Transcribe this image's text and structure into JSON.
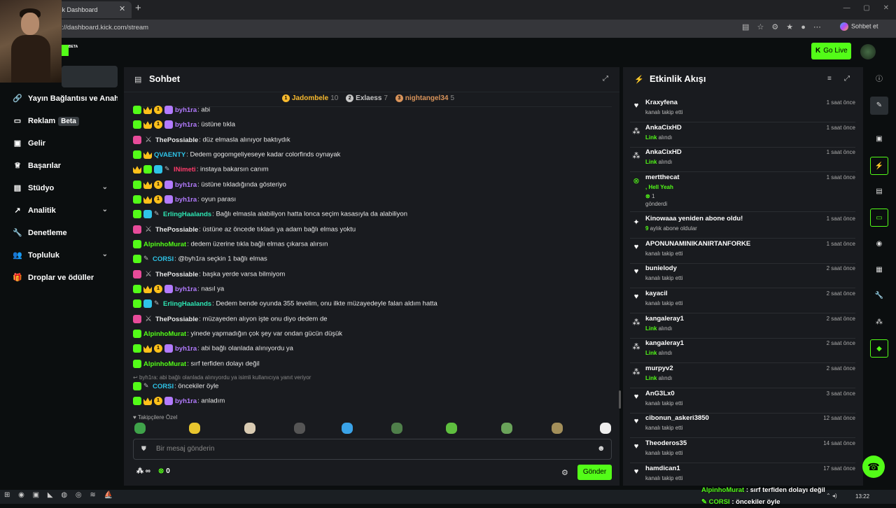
{
  "browser": {
    "tab_title": "ck Dashboard",
    "url": "://dashboard.kick.com/stream",
    "copilot_label": "Sohbet et"
  },
  "topbar": {
    "beta_tag": "BETA",
    "go_live_label": "Go Live"
  },
  "sidebar": {
    "items": [
      {
        "label": "Yayın Bağlantısı ve Anahtarı",
        "icon": "link-icon"
      },
      {
        "label": "Reklam",
        "icon": "ad-icon",
        "badge": "Beta"
      },
      {
        "label": "Gelir",
        "icon": "revenue-icon"
      },
      {
        "label": "Başarılar",
        "icon": "trophy-icon"
      },
      {
        "label": "Stüdyo",
        "icon": "studio-icon",
        "expandable": true
      },
      {
        "label": "Analitik",
        "icon": "analytics-icon",
        "expandable": true
      },
      {
        "label": "Denetleme",
        "icon": "wrench-icon"
      },
      {
        "label": "Topluluk",
        "icon": "community-icon",
        "expandable": true
      },
      {
        "label": "Droplar ve ödüller",
        "icon": "gift-icon"
      }
    ]
  },
  "chat": {
    "title": "Sohbet",
    "leaderboard": [
      {
        "rank": "1",
        "name": "Jadombele",
        "count": "10",
        "color": "#f5b82e"
      },
      {
        "rank": "2",
        "name": "Exlaess",
        "count": "7",
        "color": "#c7c7c7"
      },
      {
        "rank": "3",
        "name": "nightangel34",
        "count": "5",
        "color": "#d8935a"
      }
    ],
    "messages": [
      {
        "user": "byh1ra",
        "color": "#b37bff",
        "text": ": abi"
      },
      {
        "user": "byh1ra",
        "color": "#b37bff",
        "text": ": üstüne tıkla"
      },
      {
        "user": "ThePossiable",
        "color": "#e8e8e8",
        "text": ": düz elmasla alınıyor baktıydık"
      },
      {
        "user": "QVAENTY",
        "color": "#2ec4e8",
        "text": ": Dedem gogomgeliyeseye kadar colorfinds oynayak"
      },
      {
        "user": "INimeti",
        "color": "#ff3b6b",
        "text": ": instaya bakarsın canım"
      },
      {
        "user": "byh1ra",
        "color": "#b37bff",
        "text": ": üstüne tıkladığında gösteriyo"
      },
      {
        "user": "byh1ra",
        "color": "#b37bff",
        "text": ": oyun parası"
      },
      {
        "user": "ErlingHaalands",
        "color": "#2ee8b5",
        "text": ": Bağlı elmasla alabiliyon hatta lonca seçim kasasıyla da alabiliyon"
      },
      {
        "user": "ThePossiable",
        "color": "#e8e8e8",
        "text": ": üstüne az öncede tıkladı ya adam bağlı elmas yoktu"
      },
      {
        "user": "AlpinhoMurat",
        "color": "#53fc18",
        "text": ": dedem üzerine tıkla bağlı elmas çıkarsa alırsın"
      },
      {
        "user": "CORSI",
        "color": "#2ec4e8",
        "text": ": @byh1ra seçkin 1 bağlı elmas"
      },
      {
        "user": "ThePossiable",
        "color": "#e8e8e8",
        "text": ": başka yerde varsa bilmiyom"
      },
      {
        "user": "byh1ra",
        "color": "#b37bff",
        "text": ": nasıl ya"
      },
      {
        "user": "ErlingHaalands",
        "color": "#2ee8b5",
        "text": ": Dedem bende oyunda 355 levelim, onu ilkte müzayedeyle falan aldım hatta"
      },
      {
        "user": "ThePossiable",
        "color": "#e8e8e8",
        "text": ": müzayeden alıyon işte onu diyo dedem de"
      },
      {
        "user": "AlpinhoMurat",
        "color": "#53fc18",
        "text": ": yinede yapmadığın çok şey var ondan gücün düşük"
      },
      {
        "user": "byh1ra",
        "color": "#b37bff",
        "text": ": abi bağlı olanlada alınıyordu ya"
      },
      {
        "user": "AlpinhoMurat",
        "color": "#53fc18",
        "text": ": sırf terfiden dolayı değil"
      },
      {
        "user": "CORSI",
        "color": "#2ec4e8",
        "text": ": öncekiler öyle"
      },
      {
        "user": "byh1ra",
        "color": "#b37bff",
        "text": ": anladım"
      }
    ],
    "reply_hint": "byh1ra: abi bağlı olanlada alınıyordu ya isimli kullanıcıya yanıt veriyor",
    "followers_label": "Takipçilere Özel",
    "input_placeholder": "Bir mesaj gönderin",
    "points_value": "∞",
    "kick_points": "0",
    "send_label": "Gönder"
  },
  "feed": {
    "title": "Etkinlik Akışı",
    "events": [
      {
        "name": "Kraxyfena",
        "sub": "kanalı takip etti",
        "time": "1 saat önce",
        "icon": "heart-icon"
      },
      {
        "name": "AnkaCixHD",
        "sub_bold": "Link",
        "sub": " alındı",
        "time": "1 saat önce",
        "icon": "reward-icon"
      },
      {
        "name": "AnkaCixHD",
        "sub_bold": "Link",
        "sub": " alındı",
        "time": "1 saat önce",
        "icon": "reward-icon"
      },
      {
        "name": "mertthecat",
        "sub_bold": ", Hell Yeah",
        "sub2": "1",
        "sub": "gönderdi",
        "time": "1 saat önce",
        "icon": "kicks-icon"
      },
      {
        "name": "Kinowaaa yeniden abone oldu!",
        "sub_bold": "9",
        "sub": " aylık abone oldular",
        "time": "1 saat önce",
        "icon": "star-icon"
      },
      {
        "name": "APONUNAMINIKANIRTANFORKE",
        "sub": "kanalı takip etti",
        "time": "1 saat önce",
        "icon": "heart-icon"
      },
      {
        "name": "bunielody",
        "sub": "kanalı takip etti",
        "time": "2 saat önce",
        "icon": "heart-icon"
      },
      {
        "name": "kayacil",
        "sub": "kanalı takip etti",
        "time": "2 saat önce",
        "icon": "heart-icon"
      },
      {
        "name": "kangaleray1",
        "sub_bold": "Link",
        "sub": " alındı",
        "time": "2 saat önce",
        "icon": "reward-icon"
      },
      {
        "name": "kangaleray1",
        "sub_bold": "Link",
        "sub": " alındı",
        "time": "2 saat önce",
        "icon": "reward-icon"
      },
      {
        "name": "murpyv2",
        "sub_bold": "Link",
        "sub": " alındı",
        "time": "2 saat önce",
        "icon": "reward-icon"
      },
      {
        "name": "AnG3Lx0",
        "sub": "kanalı takip etti",
        "time": "3 saat önce",
        "icon": "heart-icon"
      },
      {
        "name": "cibonun_askeri3850",
        "sub": "kanalı takip etti",
        "time": "12 saat önce",
        "icon": "heart-icon"
      },
      {
        "name": "Theoderos35",
        "sub": "kanalı takip etti",
        "time": "14 saat önce",
        "icon": "heart-icon"
      },
      {
        "name": "hamdican1",
        "sub": "kanalı takip etti",
        "time": "17 saat önce",
        "icon": "heart-icon"
      }
    ]
  },
  "taskbar": {
    "clock": "13:22"
  },
  "overlay": {
    "lines": [
      {
        "user": "AlpinhoMurat",
        "text": " : sırf terfiden dolayı değil"
      },
      {
        "user": "CORSI",
        "text": " : öncekiler öyle"
      }
    ]
  },
  "colors": {
    "accent": "#53fc18",
    "panel": "#191b1f",
    "background": "#0b0e0f"
  }
}
